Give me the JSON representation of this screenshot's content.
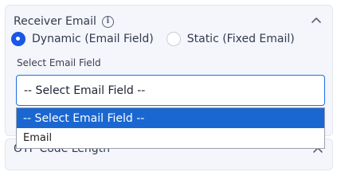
{
  "receiver_panel": {
    "title": "Receiver Email",
    "info_icon": "info-icon",
    "collapse_icon": "chevron-up-icon"
  },
  "radios": [
    {
      "label": "Dynamic (Email Field)",
      "checked": true
    },
    {
      "label": "Static (Fixed Email)",
      "checked": false
    }
  ],
  "select_field": {
    "label": "Select Email Field",
    "value": "-- Select Email Field --",
    "options": [
      "-- Select Email Field --",
      "Email"
    ],
    "highlighted_index": 0
  },
  "next_panel": {
    "title": "OTP Code Length",
    "collapse_icon": "chevron-up-icon"
  },
  "colors": {
    "accent": "#1a56e8",
    "highlight": "#1a67d2",
    "panel_bg": "#f4f6fb"
  }
}
